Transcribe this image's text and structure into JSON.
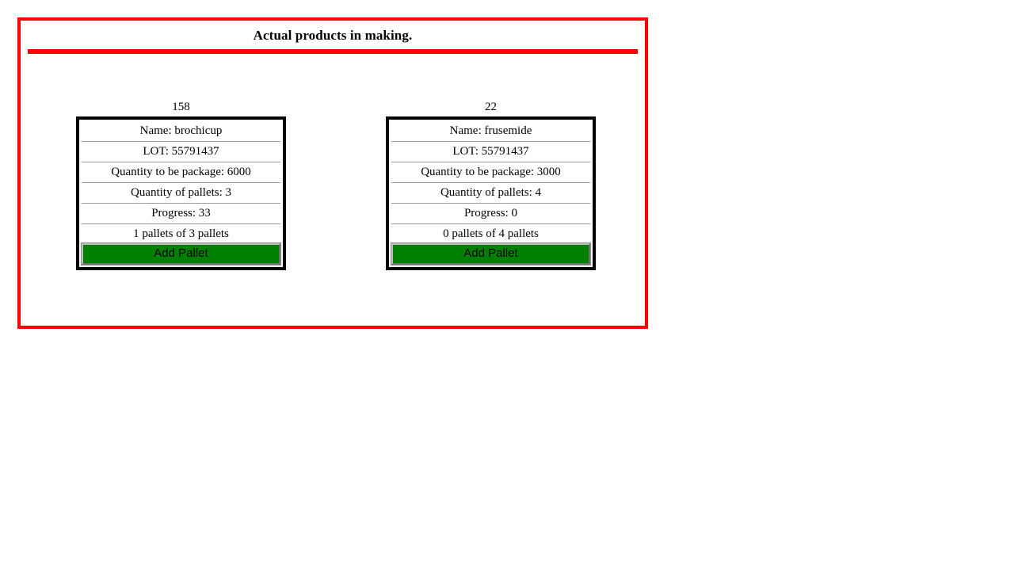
{
  "panel": {
    "title": "Actual products in making.",
    "border_color": "#ff0000",
    "rule_color": "#ff0000"
  },
  "labels": {
    "name_prefix": "Name: ",
    "lot_prefix": "LOT: ",
    "quantity_package_prefix": "Quantity to be package: ",
    "quantity_pallets_prefix": "Quantity of pallets: ",
    "progress_prefix": "Progress: ",
    "add_pallet_button": "Add Pallet",
    "button_color": "#008000"
  },
  "cards": [
    {
      "id": "158",
      "name_row": "Name: brochicup",
      "lot_row": "LOT: 55791437",
      "quantity_package_row": "Quantity to be package: 6000",
      "quantity_pallets_row": "Quantity of pallets: 3",
      "progress_row": "Progress: 33",
      "pallets_status_row": "1 pallets of 3 pallets",
      "button_label": "Add Pallet",
      "name": "brochicup",
      "lot": "55791437",
      "quantity_to_be_package": 6000,
      "quantity_of_pallets": 3,
      "progress": 33,
      "pallets_done": 1,
      "pallets_total": 3
    },
    {
      "id": "22",
      "name_row": "Name: frusemide",
      "lot_row": "LOT: 55791437",
      "quantity_package_row": "Quantity to be package: 3000",
      "quantity_pallets_row": "Quantity of pallets: 4",
      "progress_row": "Progress: 0",
      "pallets_status_row": "0 pallets of 4 pallets",
      "button_label": "Add Pallet",
      "name": "frusemide",
      "lot": "55791437",
      "quantity_to_be_package": 3000,
      "quantity_of_pallets": 4,
      "progress": 0,
      "pallets_done": 0,
      "pallets_total": 4
    }
  ]
}
